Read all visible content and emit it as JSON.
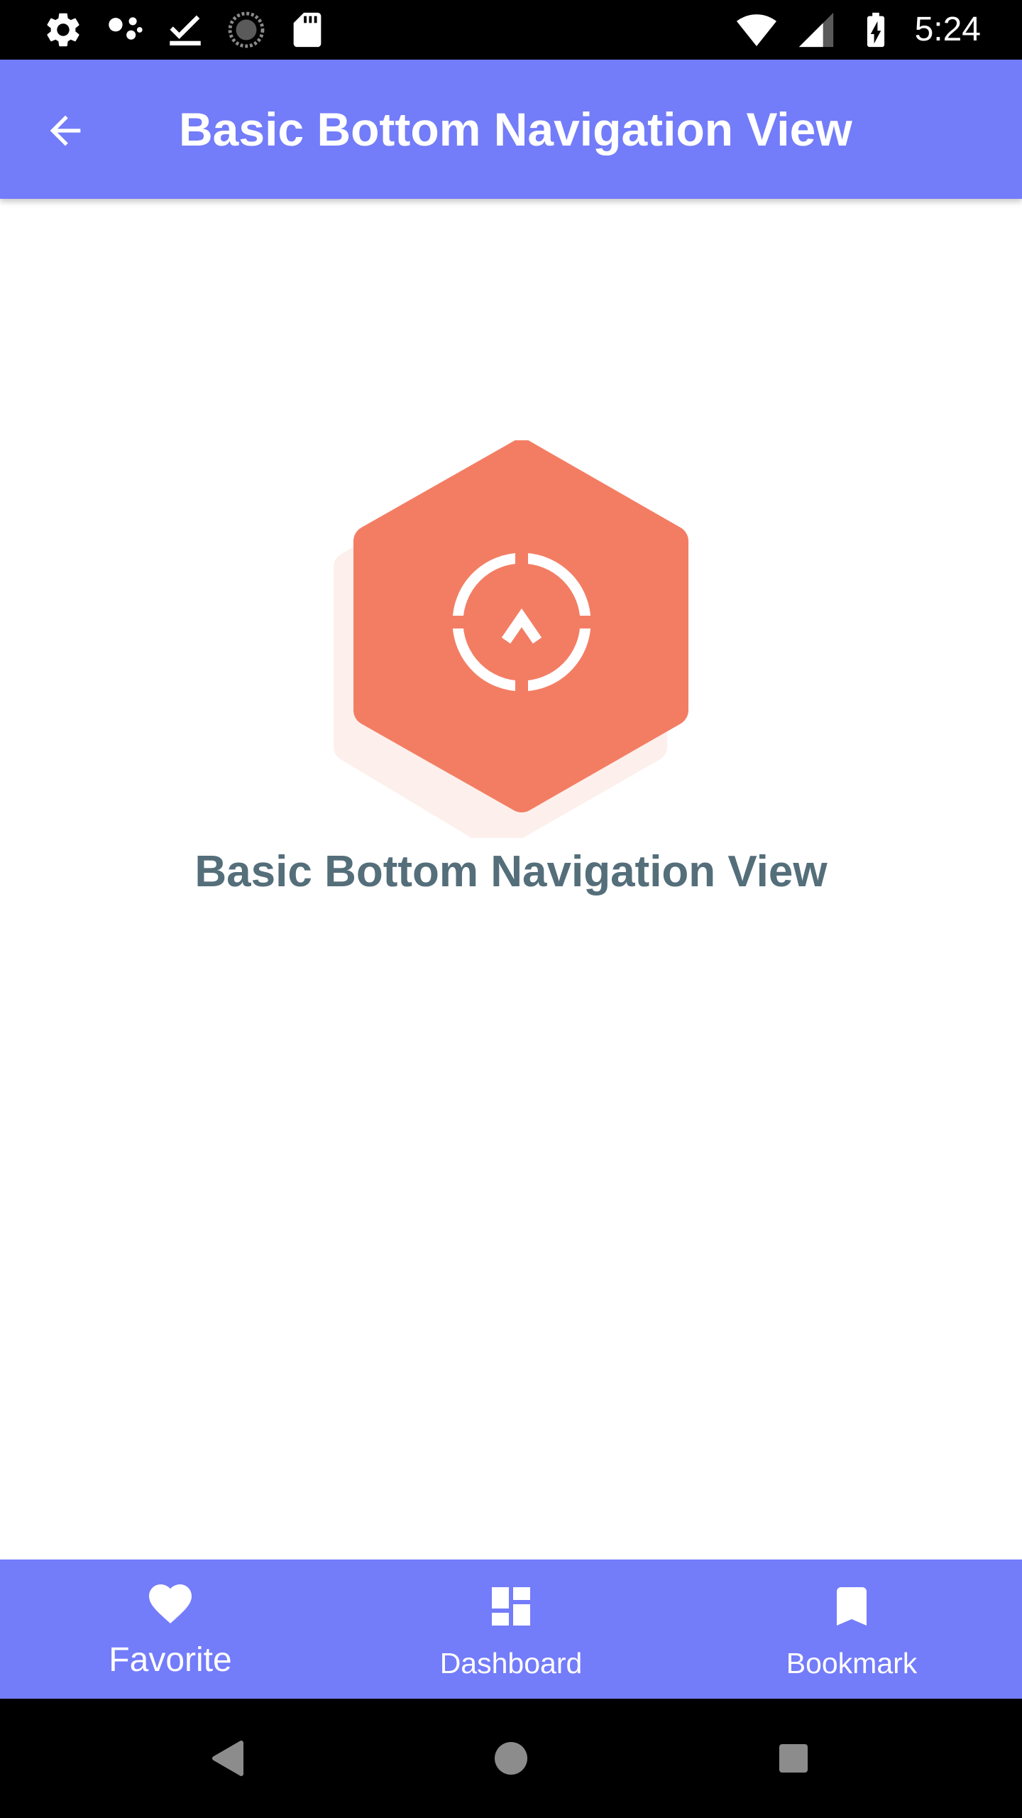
{
  "status_bar": {
    "left_icons": [
      "settings-icon",
      "assistant-icon",
      "download-done-icon",
      "sync-icon",
      "sd-card-icon"
    ],
    "right_icons": [
      "wifi-icon",
      "signal-icon",
      "battery-charging-icon"
    ],
    "time": "5:24"
  },
  "app_bar": {
    "back_icon": "arrow-back-icon",
    "title": "Basic Bottom Navigation View"
  },
  "main": {
    "hero_icon": "target-hexagon-icon",
    "title": "Basic Bottom Navigation View"
  },
  "bottom_nav": {
    "items": [
      {
        "label": "Favorite",
        "icon": "heart-icon",
        "active": true
      },
      {
        "label": "Dashboard",
        "icon": "dashboard-icon",
        "active": false
      },
      {
        "label": "Bookmark",
        "icon": "bookmark-icon",
        "active": false
      }
    ]
  },
  "system_nav": {
    "buttons": [
      "back-triangle-icon",
      "home-circle-icon",
      "recents-square-icon"
    ]
  },
  "colors": {
    "primary": "#737cf9",
    "hero_orange": "#f37d63",
    "hero_shadow": "#fdf0ec",
    "title_text": "#546e7a",
    "status_bar": "#000000"
  }
}
